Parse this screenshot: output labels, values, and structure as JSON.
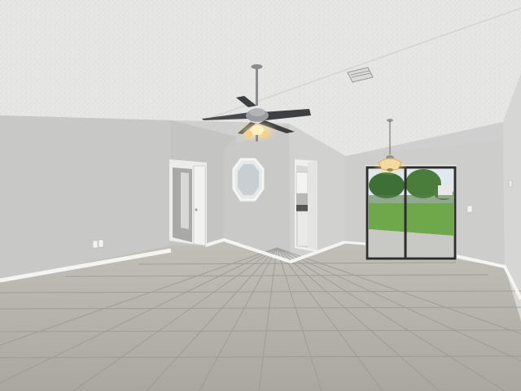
{
  "scene": {
    "subject": "empty-living-room-interior",
    "colors": {
      "ceiling": "#e6e6e4",
      "wall_left": "#c8c8c6",
      "wall_back": "#cdcdcb",
      "wall_right": "#d6d6d4",
      "baseboard": "#f4f4f2",
      "floor_base": "#b3b0ab",
      "grout": "#9c9993",
      "door_trim": "#ececea",
      "fan_metal": "#8a8c90",
      "fan_blade": "#3e3f42",
      "light_glow": "#f8d27a",
      "grass": "#6fa84a",
      "trees": "#3e6f36",
      "sky": "#dfe9ef",
      "patio": "#c8c8c4"
    },
    "objects": [
      "ceiling-fan",
      "pendant-light",
      "sliding-glass-door",
      "octagon-window",
      "interior-doorway",
      "kitchen-opening",
      "ceiling-vent",
      "wall-outlet",
      "tile-floor"
    ]
  }
}
